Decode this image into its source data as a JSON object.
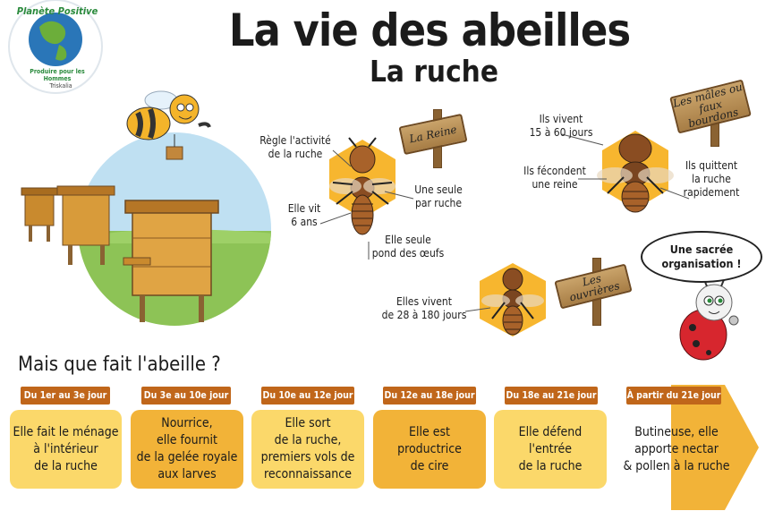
{
  "title": "La vie des abeilles",
  "subtitle": "La ruche",
  "logo": {
    "brand": "Planète Positive",
    "tagline": "Produire pour les Hommes",
    "company": "Triskalia"
  },
  "queen": {
    "sign": "La Reine",
    "labels": [
      "Règle l'activité\nde la ruche",
      "Elle vit\n6 ans",
      "Une seule\npar ruche",
      "Elle seule\npond des œufs"
    ]
  },
  "males": {
    "sign": "Les mâles ou\nfaux bourdons",
    "labels": [
      "Ils vivent\n15 à 60 jours",
      "Ils fécondent\nune reine",
      "Ils quittent\nla ruche\nrapidement"
    ]
  },
  "workers": {
    "sign": "Les ouvrières",
    "labels": [
      "Elles vivent\nde 28 à 180 jours"
    ]
  },
  "speech": "Une sacrée\norganisation !",
  "question": "Mais que fait l'abeille ?",
  "stages": [
    {
      "period": "Du 1er au 3e jour",
      "text": "Elle fait le ménage\nà l'intérieur\nde la ruche"
    },
    {
      "period": "Du 3e au 10e jour",
      "text": "Nourrice,\nelle fournit\nde la gelée royale\naux larves"
    },
    {
      "period": "Du 10e au 12e jour",
      "text": "Elle sort\nde la ruche,\npremiers vols de\nreconnaissance"
    },
    {
      "period": "Du 12e au 18e jour",
      "text": "Elle est\nproductrice\nde cire"
    },
    {
      "period": "Du 18e au 21e jour",
      "text": "Elle défend\nl'entrée\nde la ruche"
    },
    {
      "period": "À partir du 21e jour",
      "text": "Butineuse, elle\napporte nectar\n& pollen à la ruche"
    }
  ],
  "colors": {
    "tag": "#c0661a",
    "box_light": "#fbd86a",
    "box_dark": "#f2b338",
    "arrow": "#f2b338",
    "hexagon": "#f7b62f"
  }
}
